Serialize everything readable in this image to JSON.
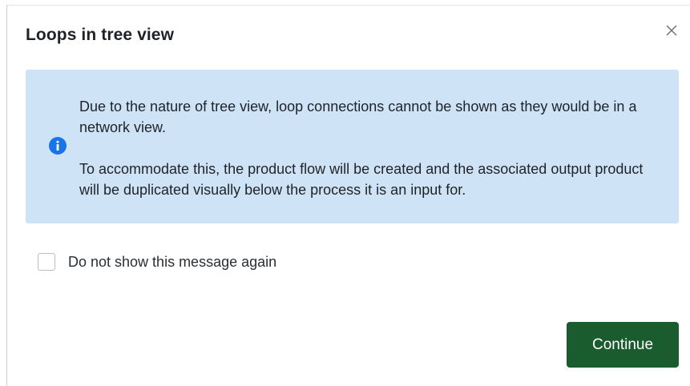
{
  "dialog": {
    "title": "Loops in tree view",
    "close_icon": "close-icon"
  },
  "info": {
    "icon": "info-icon",
    "paragraph_1": "Due to the nature of tree view, loop connections cannot be shown as they would be in a network view.",
    "paragraph_2": "To accommodate this, the product flow will be created and the associated output product will be duplicated visually below the process it is an input for."
  },
  "checkbox": {
    "label": "Do not show this message again",
    "checked": false
  },
  "actions": {
    "continue_label": "Continue"
  },
  "colors": {
    "info_background": "#cfe3f7",
    "info_icon": "#1a73e8",
    "primary_button": "#1a5c2e"
  }
}
